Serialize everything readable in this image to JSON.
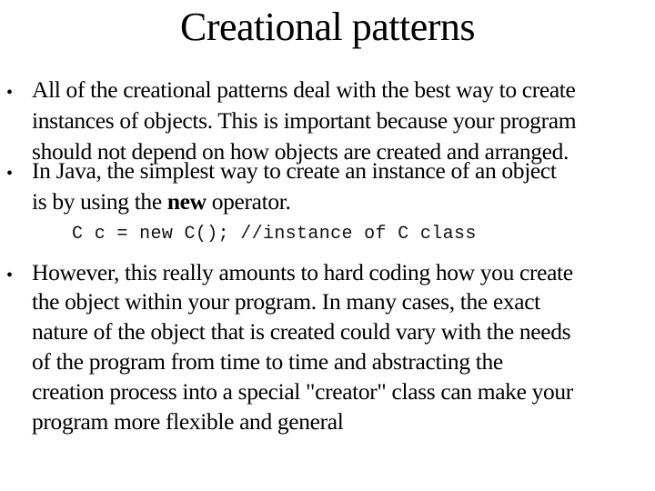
{
  "slide": {
    "title": "Creational patterns",
    "bullets": [
      {
        "lines": [
          "All of the creational patterns deal with the best way to create",
          "instances of objects. This is important because your program",
          "should not depend on how objects are created and arranged."
        ]
      },
      {
        "line1": "In Java, the simplest way to create an instance of an object",
        "line2_before": "is by using the ",
        "line2_bold": "new",
        "line2_after": " operator."
      },
      {
        "lines": [
          "However, this really amounts to hard coding how you create",
          "the object within your program. In many cases, the exact",
          "nature of the object that is created could vary with the needs",
          "of the program from time to time and abstracting the",
          "creation process into a special \"creator\" class can make your",
          "program more flexible and general"
        ]
      }
    ],
    "code_example": "C c = new C(); //instance of C class",
    "bullet_glyph": "•"
  }
}
